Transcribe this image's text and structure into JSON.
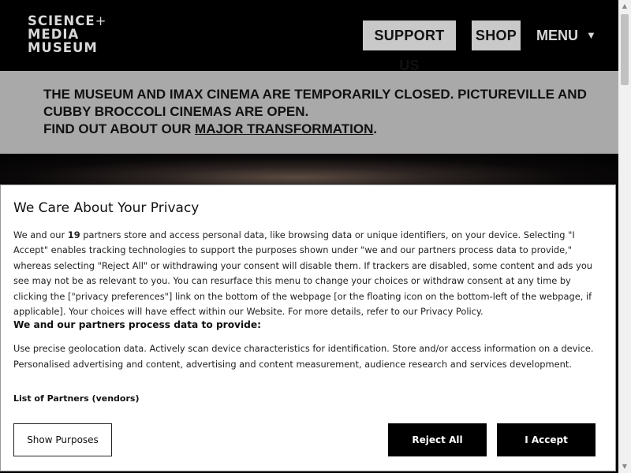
{
  "header": {
    "logo": {
      "line1_bold": "SCIENCE",
      "line1_thin": "+",
      "line2_bold": "MEDIA",
      "line3_bold": "MUSEUM"
    },
    "support_label": "SUPPORT US",
    "shop_label": "SHOP",
    "menu_label": "MENU",
    "menu_caret": "▼"
  },
  "notice": {
    "line1": "THE MUSEUM AND IMAX CINEMA ARE TEMPORARILY CLOSED. PICTUREVILLE AND",
    "line2": "CUBBY BROCCOLI CINEMAS ARE OPEN.",
    "line3_prefix": "FIND OUT ABOUT OUR ",
    "line3_link": "MAJOR TRANSFORMATION",
    "line3_suffix": "."
  },
  "privacy": {
    "title": "We Care About Your Privacy",
    "body_prefix": "We and our ",
    "partner_count": "19",
    "body_rest": " partners store and access personal data, like browsing data or unique identifiers, on your device. Selecting \"I Accept\" enables tracking technologies to support the purposes shown under \"we and our partners process data to provide,\" whereas selecting \"Reject All\" or withdrawing your consent will disable them. If trackers are disabled, some content and ads you see may not be as relevant to you. You can resurface this menu to change your choices or withdraw consent at any time by clicking the [\"privacy preferences\"] link on the bottom of the webpage [or the floating icon on the bottom-left of the webpage, if applicable]. Your choices will have effect within our Website. For more details, refer to our Privacy Policy.",
    "subhead": "We and our partners process data to provide:",
    "purposes": "Use precise geolocation data. Actively scan device characteristics for identification. Store and/or access information on a device. Personalised advertising and content, advertising and content measurement, audience research and services development.",
    "partners_link": "List of Partners (vendors)",
    "show_purposes_label": "Show Purposes",
    "reject_label": "Reject All",
    "accept_label": "I Accept"
  },
  "colors": {
    "header_bg": "#000000",
    "button_bg": "#c9c9c9",
    "notice_bg": "#a9a9a9",
    "dialog_bg": "#ffffff",
    "primary_button_bg": "#000000"
  }
}
